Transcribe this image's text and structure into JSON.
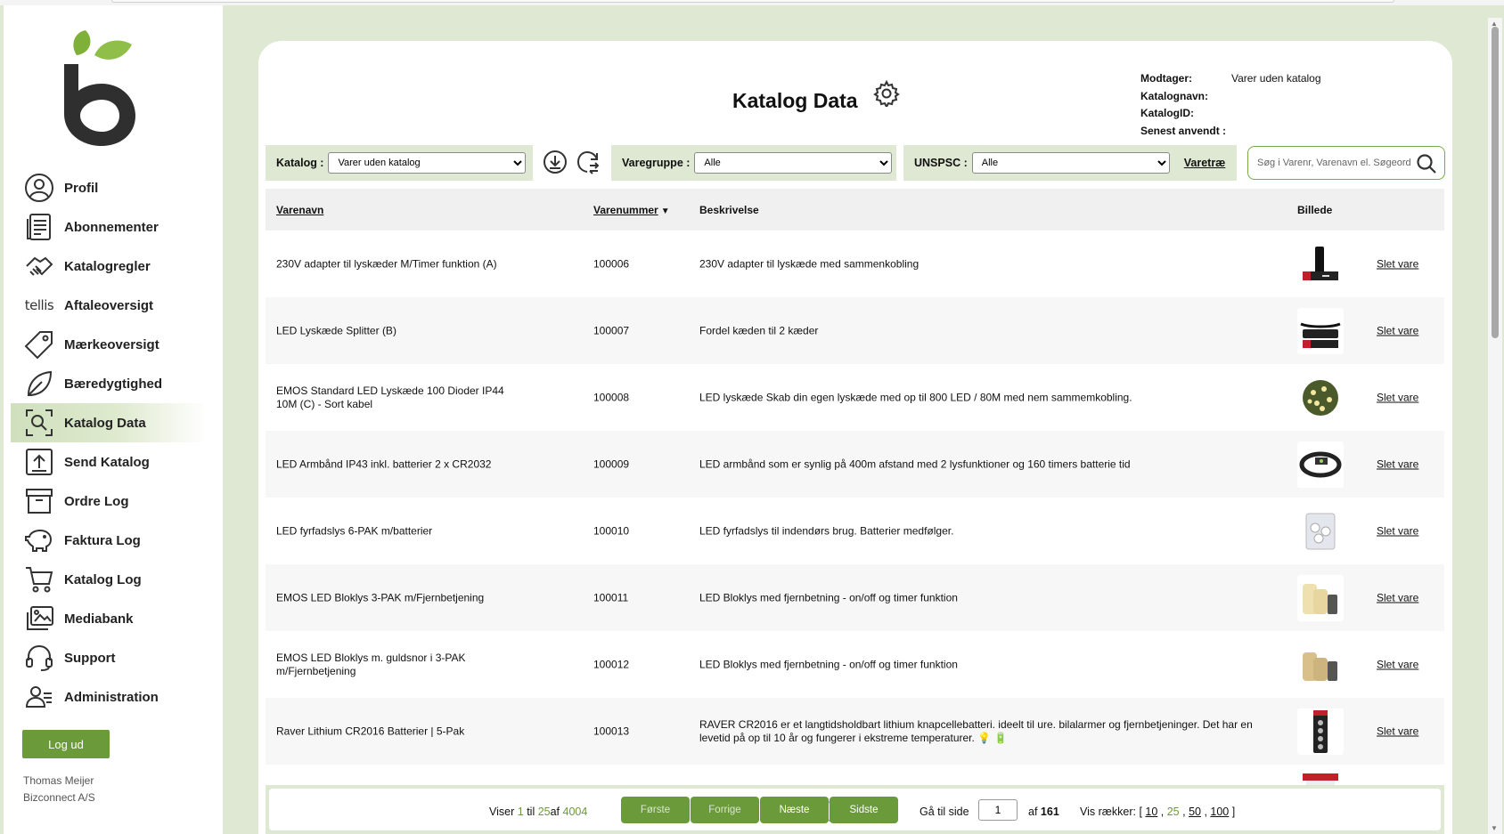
{
  "sidebar": {
    "items": [
      {
        "label": "Profil",
        "icon": "profile-icon"
      },
      {
        "label": "Abonnementer",
        "icon": "document-icon"
      },
      {
        "label": "Katalogregler",
        "icon": "handshake-icon"
      },
      {
        "label": "Aftaleoversigt",
        "icon": "tellis-logo",
        "prefix": "tellis"
      },
      {
        "label": "Mærkeoversigt",
        "icon": "tag-icon"
      },
      {
        "label": "Bæredygtighed",
        "icon": "leaf-icon"
      },
      {
        "label": "Katalog Data",
        "icon": "search-frame-icon",
        "active": true
      },
      {
        "label": "Send Katalog",
        "icon": "upload-icon"
      },
      {
        "label": "Ordre Log",
        "icon": "box-icon"
      },
      {
        "label": "Faktura Log",
        "icon": "piggy-bank-icon"
      },
      {
        "label": "Katalog Log",
        "icon": "cart-icon"
      },
      {
        "label": "Mediabank",
        "icon": "media-icon"
      },
      {
        "label": "Support",
        "icon": "headset-icon"
      },
      {
        "label": "Administration",
        "icon": "users-icon"
      }
    ],
    "logout_label": "Log ud",
    "user_name": "Thomas Meijer",
    "company": "Bizconnect A/S"
  },
  "header": {
    "title": "Katalog Data",
    "meta": [
      {
        "key": "Modtager:",
        "value": "Varer uden katalog"
      },
      {
        "key": "Katalognavn:",
        "value": ""
      },
      {
        "key": "KatalogID:",
        "value": ""
      },
      {
        "key": "Senest anvendt :",
        "value": ""
      }
    ]
  },
  "filters": {
    "katalog_label": "Katalog :",
    "katalog_value": "Varer uden katalog",
    "varegruppe_label": "Varegruppe :",
    "varegruppe_value": "Alle",
    "unspsc_label": "UNSPSC :",
    "unspsc_value": "Alle",
    "varetrae_label": "Varetræ",
    "search_placeholder": "Søg i Varenr, Varenavn el. Søgeord"
  },
  "table": {
    "headers": {
      "name": "Varenavn",
      "number": "Varenummer",
      "description": "Beskrivelse",
      "image": "Billede"
    },
    "delete_label": "Slet vare",
    "rows": [
      {
        "name": "230V adapter til lyskæder M/Timer funktion (A)",
        "number": "100006",
        "description": "230V adapter til lyskæde med sammenkobling"
      },
      {
        "name": "LED Lyskæde Splitter (B)",
        "number": "100007",
        "description": "Fordel kæden til 2 kæder"
      },
      {
        "name": "EMOS Standard LED Lyskæde 100 Dioder IP44 10M (C) - Sort kabel",
        "number": "100008",
        "description": "LED lyskæde Skab din egen lyskæde med op til 800 LED / 80M med nem sammemkobling."
      },
      {
        "name": "LED Armbånd IP43 inkl. batterier 2 x CR2032",
        "number": "100009",
        "description": "LED armbånd som er synlig på 400m afstand med 2 lysfunktioner og 160 timers batterie tid"
      },
      {
        "name": "LED fyrfadslys 6-PAK m/batterier",
        "number": "100010",
        "description": "LED fyrfadslys til indendørs brug. Batterier medfølger."
      },
      {
        "name": "EMOS LED Bloklys 3-PAK m/Fjernbetjening",
        "number": "100011",
        "description": "LED Bloklys med fjernbetning - on/off og timer funktion"
      },
      {
        "name": "EMOS LED Bloklys m. guldsnor i 3-PAK m/Fjernbetjening",
        "number": "100012",
        "description": "LED Bloklys med fjernbetning - on/off og timer funktion"
      },
      {
        "name": "Raver Lithium CR2016 Batterier | 5-Pak",
        "number": "100013",
        "description": "RAVER CR2016 er et langtidsholdbart lithium knapcellebatteri. ideelt til ure. bilalarmer og fjernbetjeninger. Det har en levetid på op til 10 år og fungerer i ekstreme temperaturer. 💡 🔋"
      },
      {
        "name": "",
        "number": "",
        "description": ""
      }
    ]
  },
  "pager": {
    "viser": "Viser",
    "from": "1",
    "til": "til",
    "to": "25",
    "af": "af",
    "total": "4004",
    "first": "Første",
    "prev": "Forrige",
    "next": "Næste",
    "last": "Sidste",
    "goto_label": "Gå til side",
    "page_value": "1",
    "pages_prefix": "af",
    "pages_total": "161",
    "rows_label": "Vis rækker: [",
    "rows_10": "10",
    "rows_25": "25",
    "rows_50": "50",
    "rows_100": "100",
    "rows_end": "]"
  },
  "colors": {
    "brand_green": "#6b9a3a",
    "page_bg": "#dfe8d2",
    "logo_dark": "#2f2f2f",
    "logo_leaf": "#7fb03a"
  }
}
